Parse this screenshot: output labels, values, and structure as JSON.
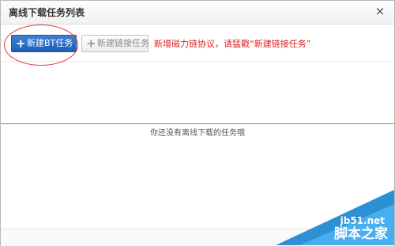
{
  "dialog": {
    "title": "离线下载任务列表",
    "close_label": "×"
  },
  "toolbar": {
    "new_bt_label": "新建BT任务",
    "new_link_label": "新建链接任务",
    "plus_glyph": "+",
    "notice": "新增磁力链协议，请猛戳“新建链接任务”"
  },
  "list": {
    "empty_message": "你还没有离线下载的任务哦"
  },
  "watermark": {
    "site": "jb51.net",
    "name": "脚本之家"
  },
  "colors": {
    "primary_button": "#1c5fb8",
    "notice_text": "#e02020",
    "highlight_oval": "#e23b3b",
    "watermark_blue": "#2d8fd4"
  },
  "icons": {
    "close": "close-icon",
    "plus": "plus-icon"
  }
}
